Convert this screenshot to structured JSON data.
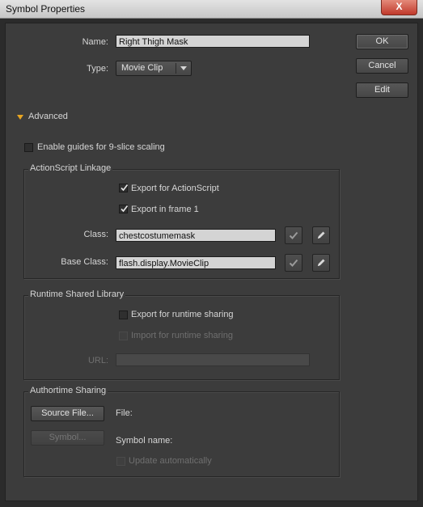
{
  "window": {
    "title": "Symbol Properties",
    "close_glyph": "X"
  },
  "name": {
    "label": "Name:",
    "value": "Right Thigh Mask"
  },
  "type": {
    "label": "Type:",
    "selected": "Movie Clip"
  },
  "buttons": {
    "ok": "OK",
    "cancel": "Cancel",
    "edit": "Edit"
  },
  "advanced": {
    "label": "Advanced"
  },
  "nine_slice": {
    "label": "Enable guides for 9-slice scaling",
    "checked": false
  },
  "actionscript": {
    "title": "ActionScript Linkage",
    "export_as": {
      "label": "Export for ActionScript",
      "checked": true
    },
    "export_frame1": {
      "label": "Export in frame 1",
      "checked": true
    },
    "class": {
      "label": "Class:",
      "value": "chestcostumemask"
    },
    "base_class": {
      "label": "Base Class:",
      "value": "flash.display.MovieClip"
    }
  },
  "runtime": {
    "title": "Runtime Shared Library",
    "export_runtime": {
      "label": "Export for runtime sharing",
      "checked": false
    },
    "import_runtime": {
      "label": "Import for runtime sharing",
      "checked": false,
      "enabled": false
    },
    "url": {
      "label": "URL:",
      "value": ""
    }
  },
  "authortime": {
    "title": "Authortime Sharing",
    "source_button": "Source File...",
    "symbol_button": "Symbol...",
    "file_label": "File:",
    "symbol_name_label": "Symbol name:",
    "update_auto": {
      "label": "Update automatically",
      "checked": false,
      "enabled": false
    }
  },
  "colors": {
    "accent_triangle": "#e8a521",
    "dialog_bg": "#3c3c3c"
  },
  "icons": [
    "close-icon",
    "dropdown-arrow-icon",
    "expand-triangle-icon",
    "checkmark-icon",
    "pencil-icon"
  ]
}
